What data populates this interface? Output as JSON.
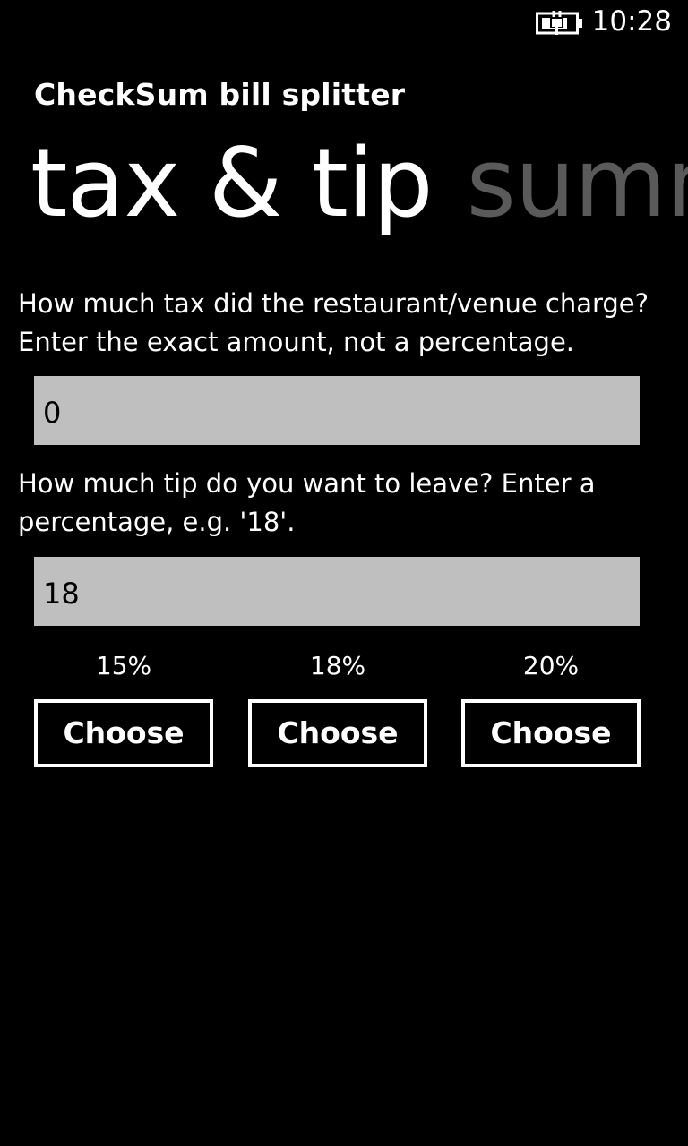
{
  "status_bar": {
    "time": "10:28",
    "battery_icon": "battery-charging-icon"
  },
  "app": {
    "title": "CheckSum bill splitter"
  },
  "pivot": {
    "active": "tax & tip",
    "next": "summ"
  },
  "tax": {
    "question": "How much tax did the restaurant/venue charge? Enter the exact amount, not a percentage.",
    "value": "0"
  },
  "tip": {
    "question": "How much tip do you want to leave? Enter a percentage, e.g. '18'.",
    "value": "18",
    "options": [
      {
        "percent": "15%",
        "button": "Choose"
      },
      {
        "percent": "18%",
        "button": "Choose"
      },
      {
        "percent": "20%",
        "button": "Choose"
      }
    ]
  },
  "colors": {
    "background": "#000000",
    "text": "#ffffff",
    "inactive_pivot": "#5a5a5a",
    "field_background": "#bfbfbf"
  }
}
